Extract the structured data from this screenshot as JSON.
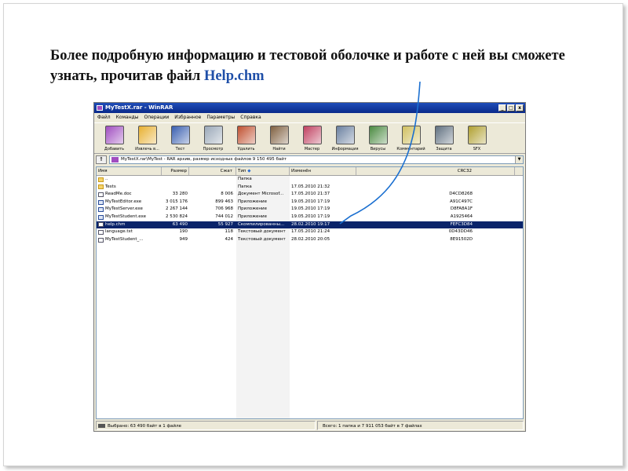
{
  "slide": {
    "text_before": "Более подробную информацию и тестовой оболочке и работе с ней вы сможете узнать, прочитав файл ",
    "link_text": "Help.chm"
  },
  "window": {
    "title": "MyTestX.rar - WinRAR",
    "controls": [
      "_",
      "□",
      "x"
    ],
    "menu": [
      "Файл",
      "Команды",
      "Операции",
      "Избранное",
      "Параметры",
      "Справка"
    ],
    "toolbar": [
      {
        "label": "Добавить",
        "icon": "add-archive-icon",
        "color": "#a04dc0"
      },
      {
        "label": "Извлечь в...",
        "icon": "extract-icon",
        "color": "#e8b030"
      },
      {
        "label": "Тест",
        "icon": "test-icon",
        "color": "#3a5fb0"
      },
      {
        "label": "Просмотр",
        "icon": "view-icon",
        "color": "#9aa8b8"
      },
      {
        "label": "Удалить",
        "icon": "delete-icon",
        "color": "#c05030"
      },
      {
        "label": "Найти",
        "icon": "find-icon",
        "color": "#806040"
      },
      {
        "label": "Мастер",
        "icon": "wizard-icon",
        "color": "#c04060"
      },
      {
        "label": "Информация",
        "icon": "info-icon",
        "color": "#6a80a0"
      },
      {
        "label": "Вирусы",
        "icon": "virus-scan-icon",
        "color": "#4a8a40"
      },
      {
        "label": "Комментарий",
        "icon": "comment-icon",
        "color": "#d0c060"
      },
      {
        "label": "Защита",
        "icon": "protect-icon",
        "color": "#607080"
      },
      {
        "label": "SFX",
        "icon": "sfx-icon",
        "color": "#b0a030"
      }
    ],
    "path": "MyTestX.rar\\MyTest - RAR архив, размер исходных файлов 9 150 495 байт",
    "columns": {
      "name": "Имя",
      "size": "Размер",
      "packed": "Сжат",
      "type": "Тип",
      "modified": "Изменён",
      "crc": "CRC32"
    },
    "files": [
      {
        "name": "..",
        "size": "",
        "packed": "",
        "type": "Папка",
        "modified": "",
        "crc": "",
        "kind": "folder"
      },
      {
        "name": "Tests",
        "size": "",
        "packed": "",
        "type": "Папка",
        "modified": "17.05.2010 21:32",
        "crc": "",
        "kind": "folder"
      },
      {
        "name": "ReadMe.doc",
        "size": "33 280",
        "packed": "8 006",
        "type": "Документ Microsof...",
        "modified": "17.05.2010 21:37",
        "crc": "D4CD8268",
        "kind": "file"
      },
      {
        "name": "MyTestEditor.exe",
        "size": "3 015 176",
        "packed": "899 463",
        "type": "Приложение",
        "modified": "19.05.2010 17:19",
        "crc": "A91C497C",
        "kind": "exe"
      },
      {
        "name": "MyTestServer.exe",
        "size": "2 267 144",
        "packed": "706 968",
        "type": "Приложение",
        "modified": "19.05.2010 17:19",
        "crc": "D8FA8A1F",
        "kind": "exe"
      },
      {
        "name": "MyTestStudent.exe",
        "size": "2 530 824",
        "packed": "744 012",
        "type": "Приложение",
        "modified": "19.05.2010 17:19",
        "crc": "A1925464",
        "kind": "exe"
      },
      {
        "name": "help.chm",
        "size": "63 490",
        "packed": "55 927",
        "type": "Скомпилированны...",
        "modified": "28.02.2010 19:17",
        "crc": "FEFC3D84",
        "kind": "file",
        "selected": true
      },
      {
        "name": "language.txt",
        "size": "190",
        "packed": "118",
        "type": "Текстовый документ",
        "modified": "17.05.2010 21:24",
        "crc": "0D43DD46",
        "kind": "file"
      },
      {
        "name": "MyTestStudent_...",
        "size": "949",
        "packed": "424",
        "type": "Текстовый документ",
        "modified": "28.02.2010 20:05",
        "crc": "8E91502D",
        "kind": "file"
      }
    ],
    "status_left": "Выбрано: 63 490 байт в 1 файле",
    "status_right": "Всего: 1 папка и 7 911 053 байт в 7 файлах"
  },
  "colors": {
    "arrow": "#1a6fd0",
    "link": "#1f4fa8",
    "selection": "#0a246a",
    "title_bar": "#0a2a8a"
  }
}
